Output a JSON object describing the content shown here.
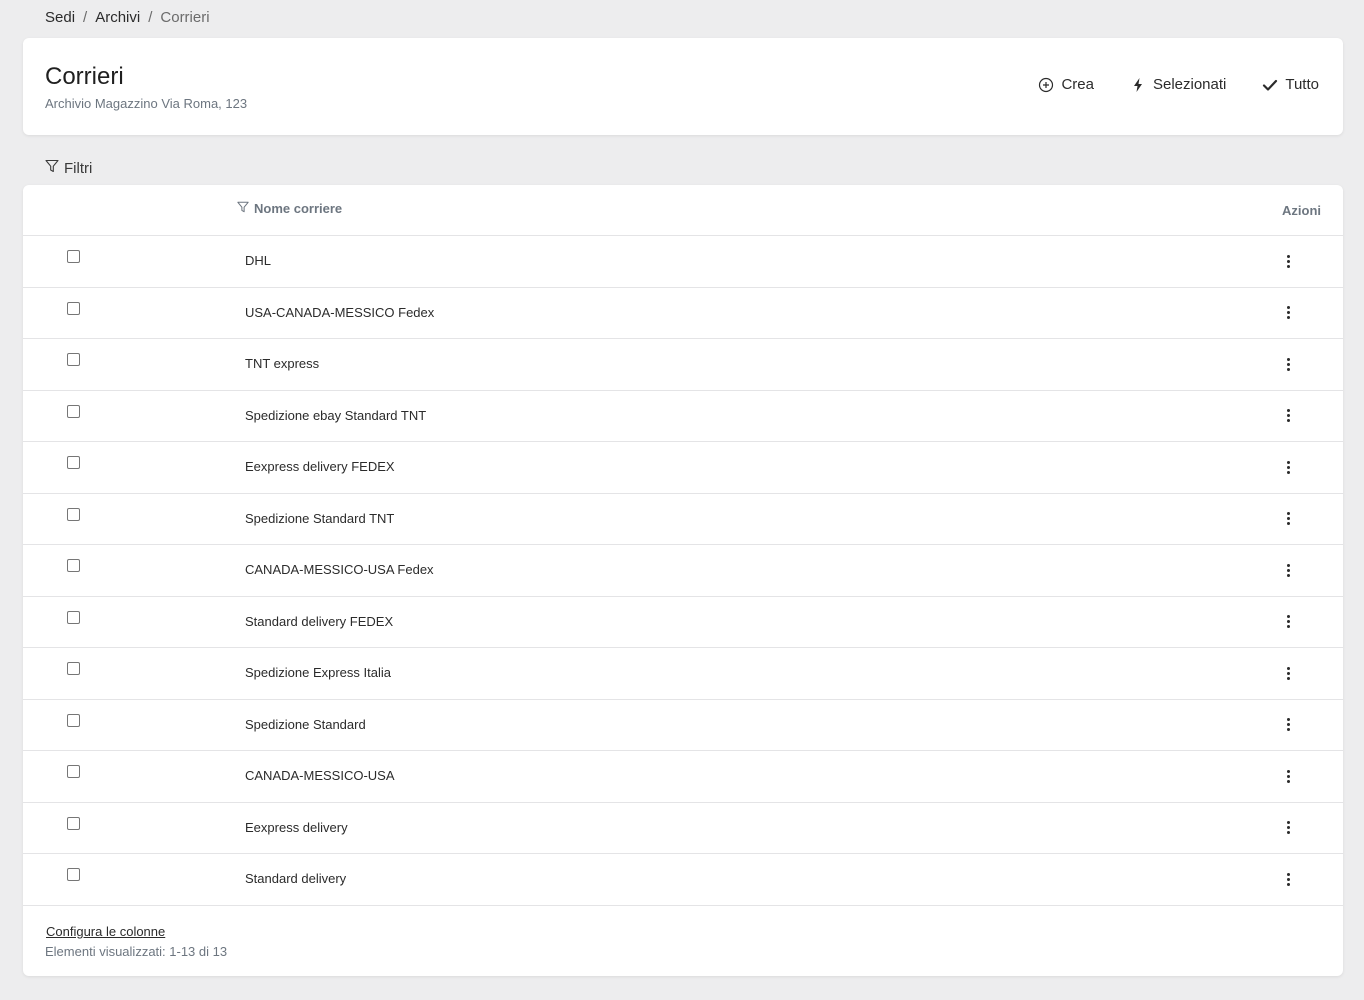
{
  "breadcrumb": {
    "items": [
      "Sedi",
      "Archivi",
      "Corrieri"
    ],
    "separator": "/"
  },
  "header": {
    "title": "Corrieri",
    "subtitle": "Archivio Magazzino Via Roma, 123"
  },
  "actions": {
    "create_label": "Crea",
    "selected_label": "Selezionati",
    "all_label": "Tutto"
  },
  "filters": {
    "label": "Filtri"
  },
  "table": {
    "columns": {
      "name": "Nome corriere",
      "actions": "Azioni"
    },
    "rows": [
      {
        "name": "DHL"
      },
      {
        "name": "USA-CANADA-MESSICO Fedex"
      },
      {
        "name": "TNT express"
      },
      {
        "name": "Spedizione ebay Standard TNT"
      },
      {
        "name": "Eexpress delivery FEDEX"
      },
      {
        "name": "Spedizione Standard TNT"
      },
      {
        "name": "CANADA-MESSICO-USA Fedex"
      },
      {
        "name": "Standard delivery FEDEX"
      },
      {
        "name": "Spedizione Express Italia"
      },
      {
        "name": "Spedizione Standard"
      },
      {
        "name": "CANADA-MESSICO-USA"
      },
      {
        "name": "Eexpress delivery"
      },
      {
        "name": "Standard delivery"
      }
    ]
  },
  "footer": {
    "configure_columns": "Configura le colonne",
    "count_text": "Elementi visualizzati: 1-13 di 13"
  },
  "icons": {
    "create": "plus-circle-icon",
    "selected": "bolt-icon",
    "all": "check-icon",
    "filter": "filter-icon",
    "row_actions": "kebab-menu-icon"
  }
}
